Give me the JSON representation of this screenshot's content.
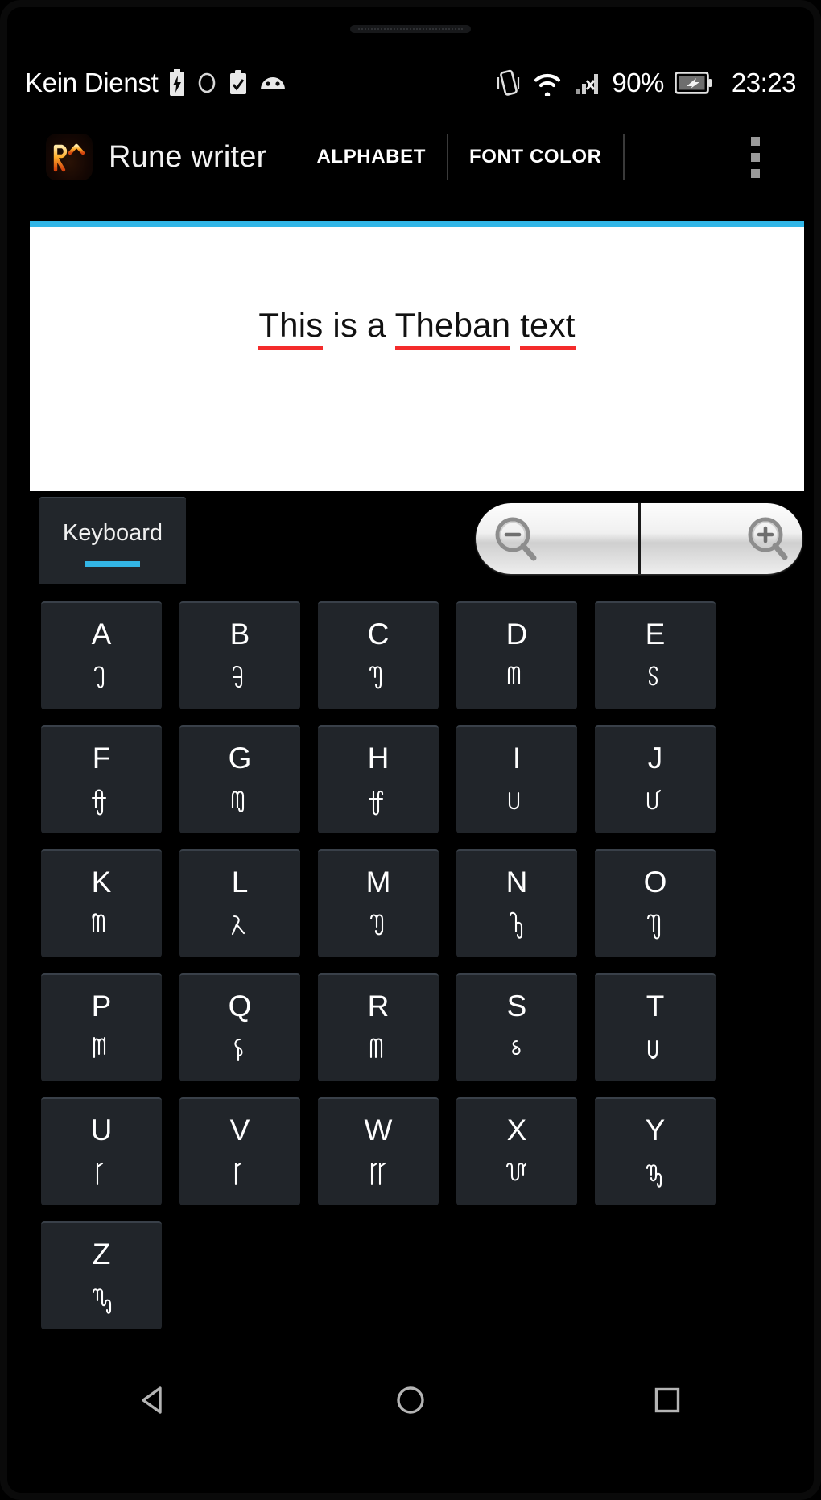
{
  "statusbar": {
    "carrier": "Kein Dienst",
    "battery_percent": "90%",
    "clock": "23:23",
    "icons": [
      "battery-charging-icon",
      "circle-icon",
      "clipboard-check-icon",
      "android-head-icon",
      "vibrate-icon",
      "wifi-icon",
      "signal-no-service-icon",
      "battery-icon"
    ]
  },
  "actionbar": {
    "logo_text": "RT",
    "title": "Rune writer",
    "menu": [
      {
        "label": "ALPHABET"
      },
      {
        "label": "FONT COLOR"
      }
    ],
    "overflow_label": "overflow-menu"
  },
  "editor": {
    "words": [
      {
        "text": "This",
        "misspelled": true
      },
      {
        "text": "is",
        "misspelled": false
      },
      {
        "text": "a",
        "misspelled": false
      },
      {
        "text": "Theban",
        "misspelled": true
      },
      {
        "text": "text",
        "misspelled": true
      }
    ],
    "full_text": "This is a Theban text",
    "accent_color": "#33b5e5",
    "spellcheck_color": "#f42b2b"
  },
  "tabs": {
    "active": "Keyboard",
    "items": [
      {
        "label": "Keyboard",
        "selected": true
      }
    ],
    "indicator_color": "#33b5e5"
  },
  "zoom_controls": {
    "zoom_out_label": "zoom-out",
    "zoom_in_label": "zoom-in"
  },
  "keyboard": {
    "keys": [
      {
        "latin": "A",
        "rune": "A"
      },
      {
        "latin": "B",
        "rune": "B"
      },
      {
        "latin": "C",
        "rune": "C"
      },
      {
        "latin": "D",
        "rune": "D"
      },
      {
        "latin": "E",
        "rune": "E"
      },
      {
        "latin": "F",
        "rune": "F"
      },
      {
        "latin": "G",
        "rune": "G"
      },
      {
        "latin": "H",
        "rune": "H"
      },
      {
        "latin": "I",
        "rune": "I"
      },
      {
        "latin": "J",
        "rune": "J"
      },
      {
        "latin": "K",
        "rune": "K"
      },
      {
        "latin": "L",
        "rune": "L"
      },
      {
        "latin": "M",
        "rune": "M"
      },
      {
        "latin": "N",
        "rune": "N"
      },
      {
        "latin": "O",
        "rune": "O"
      },
      {
        "latin": "P",
        "rune": "P"
      },
      {
        "latin": "Q",
        "rune": "Q"
      },
      {
        "latin": "R",
        "rune": "R"
      },
      {
        "latin": "S",
        "rune": "S"
      },
      {
        "latin": "T",
        "rune": "T"
      },
      {
        "latin": "U",
        "rune": "U"
      },
      {
        "latin": "V",
        "rune": "V"
      },
      {
        "latin": "W",
        "rune": "W"
      },
      {
        "latin": "X",
        "rune": "X"
      },
      {
        "latin": "Y",
        "rune": "Y"
      },
      {
        "latin": "Z",
        "rune": "Z"
      }
    ]
  },
  "navbar": {
    "back_label": "back",
    "home_label": "home",
    "recents_label": "recents"
  }
}
